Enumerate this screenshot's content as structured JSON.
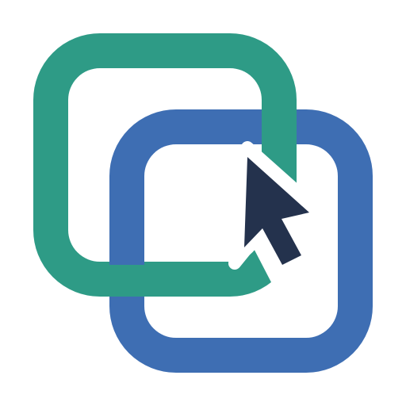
{
  "icon": {
    "name": "linked-windows-cursor-icon",
    "colors": {
      "green_square": "#2E9B86",
      "blue_square": "#3E6EB3",
      "cursor": "#24324D",
      "background": "#FFFFFF"
    }
  }
}
